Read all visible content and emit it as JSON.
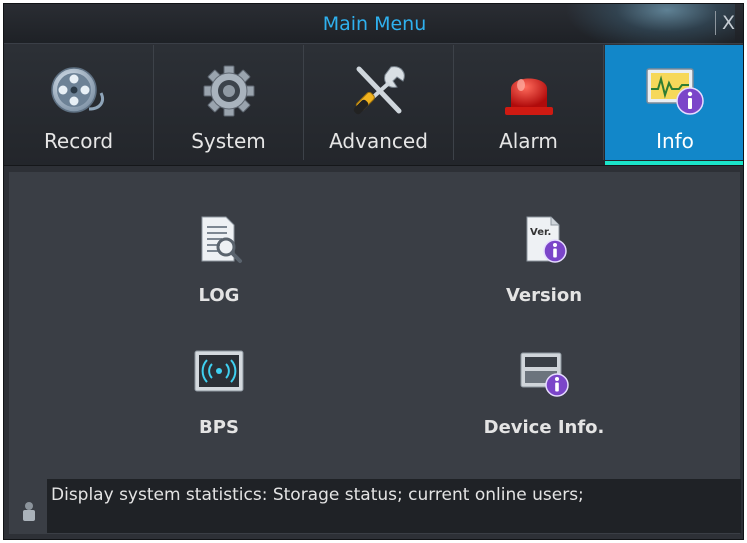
{
  "window": {
    "title": "Main Menu",
    "close_glyph": "X"
  },
  "tabs": [
    {
      "label": "Record",
      "icon": "film-reel-icon",
      "active": false
    },
    {
      "label": "System",
      "icon": "gear-icon",
      "active": false
    },
    {
      "label": "Advanced",
      "icon": "tools-icon",
      "active": false
    },
    {
      "label": "Alarm",
      "icon": "alarm-light-icon",
      "active": false
    },
    {
      "label": "Info",
      "icon": "info-monitor-icon",
      "active": true
    }
  ],
  "items": [
    {
      "label": "LOG",
      "icon": "log-document-icon"
    },
    {
      "label": "Version",
      "icon": "version-info-icon"
    },
    {
      "label": "BPS",
      "icon": "bps-signal-icon"
    },
    {
      "label": "Device Info.",
      "icon": "device-info-icon"
    }
  ],
  "status": {
    "text": "Display system statistics: Storage status; current online users;",
    "icon": "lock-icon"
  },
  "colors": {
    "title": "#2fb1ef",
    "active_tab": "#1287c9",
    "active_underline": "#1be4c9",
    "background": "#3a3e45"
  }
}
